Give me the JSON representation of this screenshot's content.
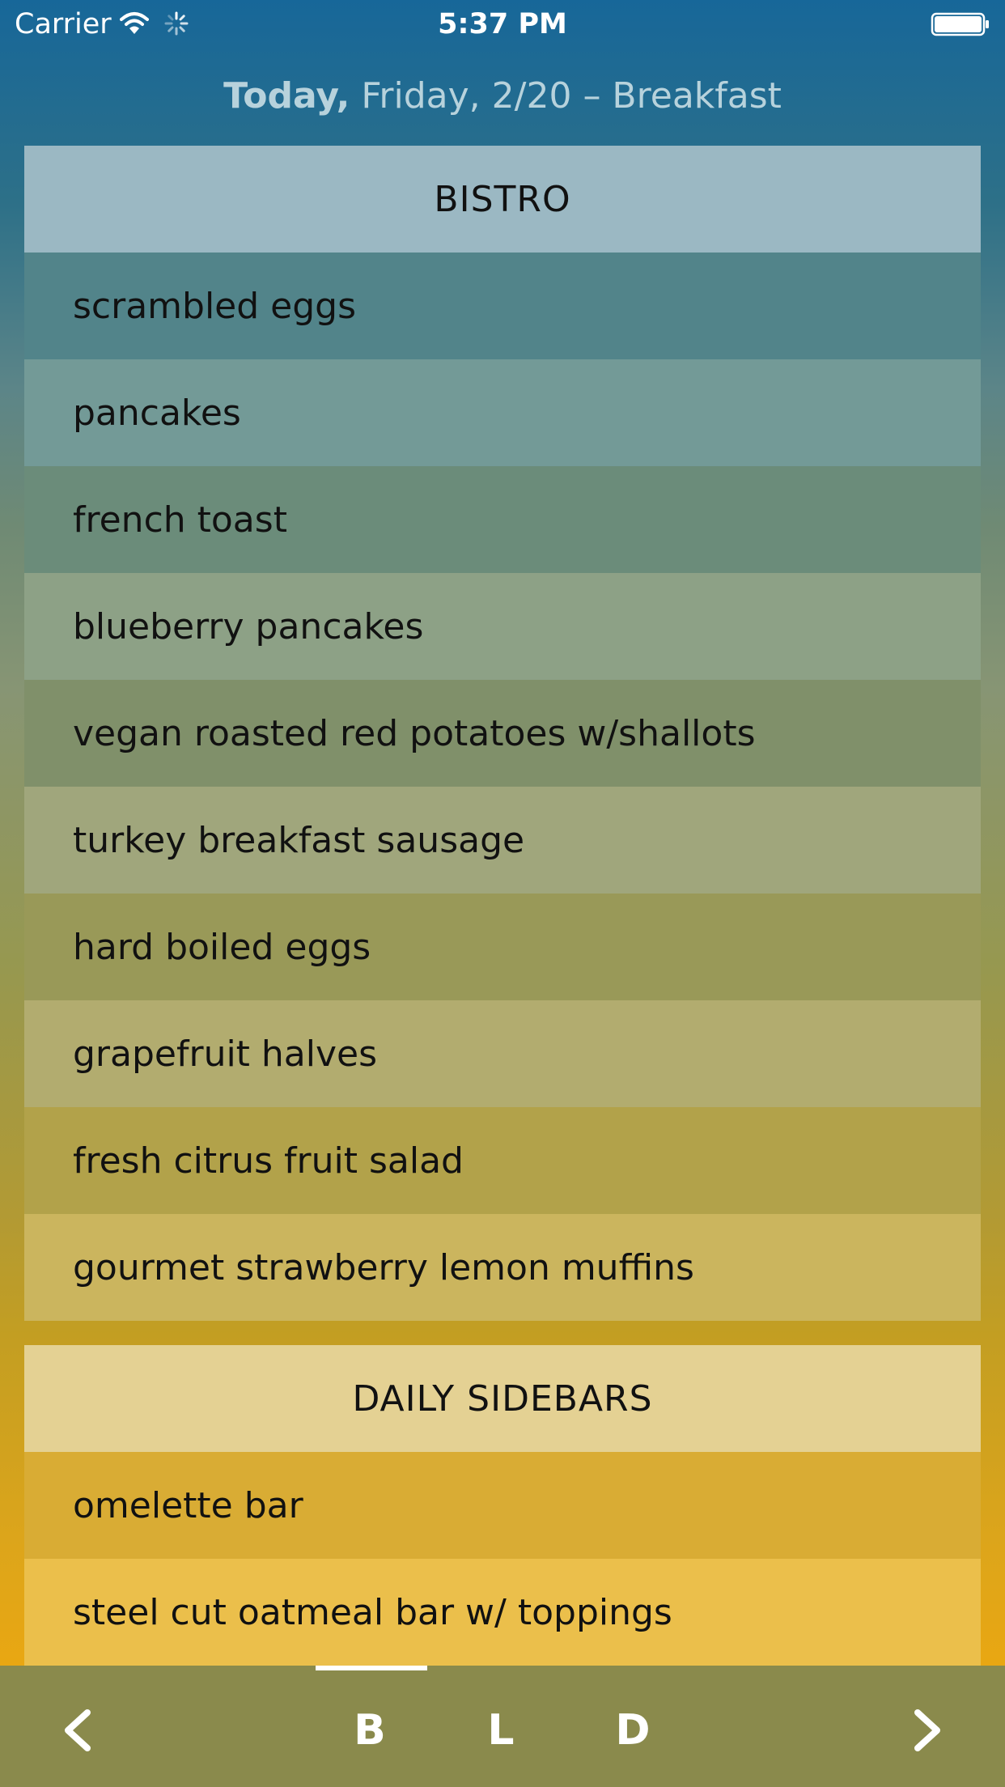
{
  "status_bar": {
    "carrier": "Carrier",
    "time": "5:37 PM"
  },
  "heading": {
    "today": "Today,",
    "date_meal": "Friday, 2/20 – Breakfast"
  },
  "sections": [
    {
      "title": "BISTRO",
      "header_color": "#9bb8c3",
      "items": [
        {
          "label": "scrambled eggs",
          "color": "#52848a"
        },
        {
          "label": "pancakes",
          "color": "#739a97"
        },
        {
          "label": "french toast",
          "color": "#6b8c7a"
        },
        {
          "label": "blueberry pancakes",
          "color": "#8da186"
        },
        {
          "label": "vegan roasted red potatoes w/shallots",
          "color": "#80906a"
        },
        {
          "label": "turkey breakfast sausage",
          "color": "#a0a67c"
        },
        {
          "label": "hard boiled eggs",
          "color": "#999958"
        },
        {
          "label": "grapefruit halves",
          "color": "#b2ac6f"
        },
        {
          "label": "fresh citrus fruit salad",
          "color": "#b2a24a"
        },
        {
          "label": "gourmet strawberry lemon muffins",
          "color": "#cbb55e"
        }
      ]
    },
    {
      "title": "DAILY SIDEBARS",
      "header_color": "#e4d193",
      "items": [
        {
          "label": "omelette bar",
          "color": "#d9ac34"
        },
        {
          "label": "steel cut oatmeal bar w/ toppings",
          "color": "#ebbf4b"
        }
      ]
    }
  ],
  "tabs": {
    "breakfast": "B",
    "lunch": "L",
    "dinner": "D",
    "selected": "breakfast"
  },
  "icons": {
    "prev": "chevron-left-icon",
    "next": "chevron-right-icon",
    "wifi": "wifi-icon",
    "activity": "activity-spinner-icon",
    "battery": "battery-icon"
  }
}
